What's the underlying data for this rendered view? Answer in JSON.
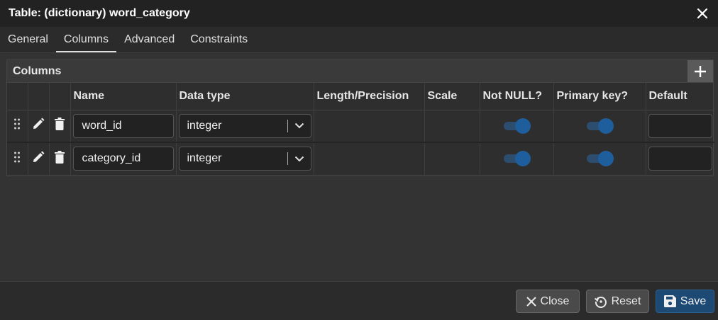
{
  "dialog": {
    "title": "Table: (dictionary) word_category"
  },
  "tabs": [
    {
      "label": "General"
    },
    {
      "label": "Columns"
    },
    {
      "label": "Advanced"
    },
    {
      "label": "Constraints"
    }
  ],
  "active_tab": "Columns",
  "columns_panel": {
    "title": "Columns",
    "headers": {
      "name": "Name",
      "data_type": "Data type",
      "length": "Length/Precision",
      "scale": "Scale",
      "not_null": "Not NULL?",
      "primary_key": "Primary key?",
      "default": "Default"
    },
    "rows": [
      {
        "name": "word_id",
        "data_type": "integer",
        "length": "",
        "scale": "",
        "not_null": true,
        "primary_key": true,
        "default": ""
      },
      {
        "name": "category_id",
        "data_type": "integer",
        "length": "",
        "scale": "",
        "not_null": true,
        "primary_key": true,
        "default": ""
      }
    ]
  },
  "footer": {
    "close_label": "Close",
    "reset_label": "Reset",
    "save_label": "Save"
  },
  "colors": {
    "toggle_on": "#1f5e9c",
    "save_button": "#1c4a75"
  },
  "icons": [
    "close-icon",
    "plus-icon",
    "drag-handle-icon",
    "edit-icon",
    "delete-icon",
    "chevron-down-icon",
    "reset-icon",
    "save-icon"
  ]
}
